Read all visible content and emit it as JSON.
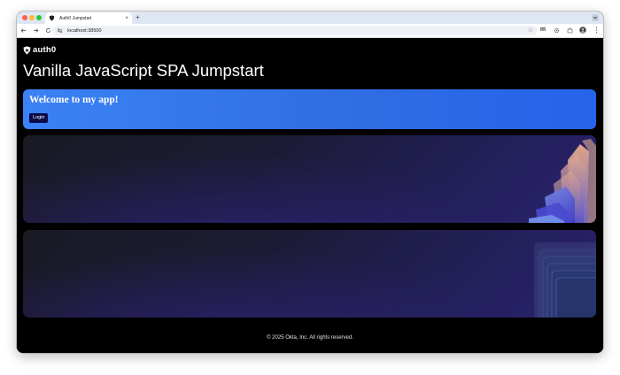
{
  "browser": {
    "tab_title": "Auth0 Jumpstart",
    "tab_close": "×",
    "new_tab": "+",
    "url": "localhost:38500",
    "star": "☆",
    "profile_initial": "m"
  },
  "header": {
    "logo_text": "auth0"
  },
  "main": {
    "title": "Vanilla JavaScript SPA Jumpstart",
    "hero": {
      "title": "Welcome to my app!",
      "login_label": "Login"
    }
  },
  "footer": {
    "copyright": "© 2025 Okta, Inc. All rights reserved."
  },
  "colors": {
    "hero_blue": "#3b82f6",
    "login_button": "#0a0a4a",
    "page_background": "#000000"
  }
}
